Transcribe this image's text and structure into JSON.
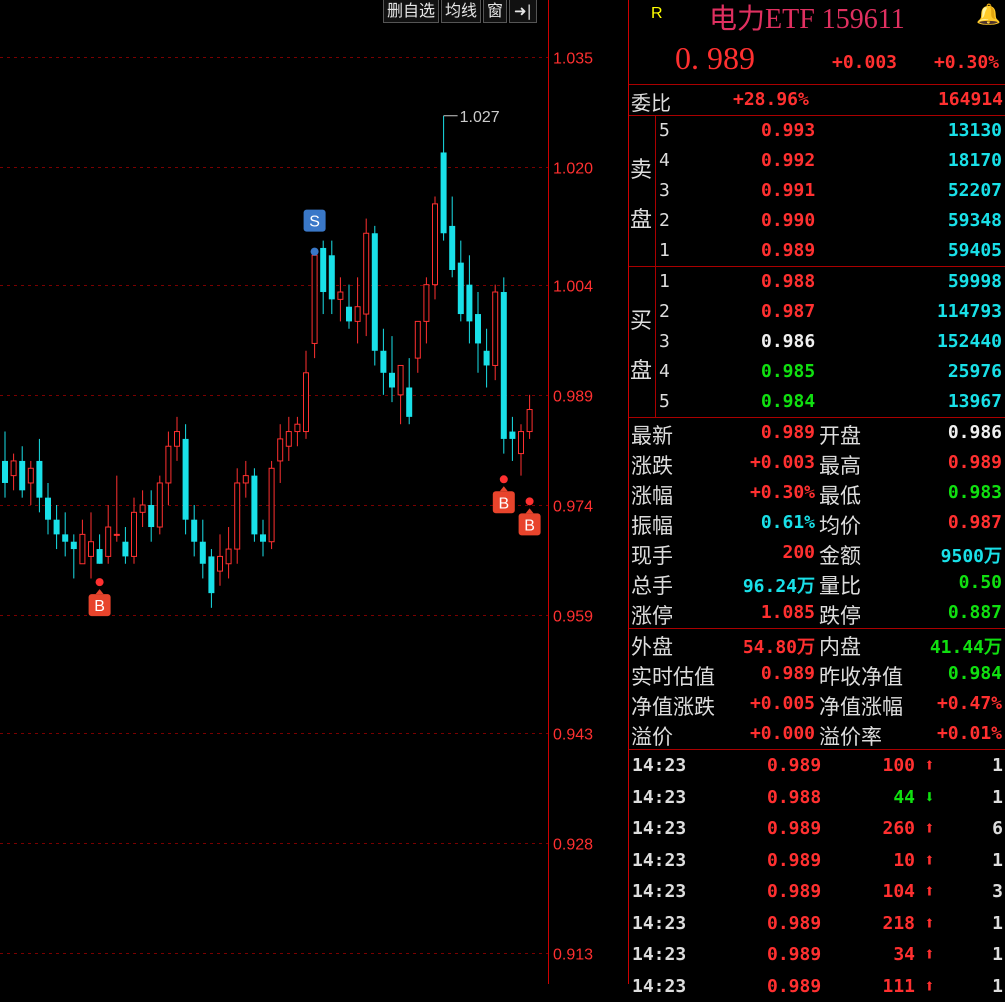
{
  "toolbar": {
    "delete_label": "删自选",
    "ma_label": "均线",
    "window_label": "窗",
    "collapse_label": "➜|"
  },
  "chart_data": {
    "type": "candlestick",
    "y_ticks": [
      "1.035",
      "1.020",
      "1.004",
      "0.989",
      "0.974",
      "0.959",
      "0.943",
      "0.928",
      "0.913"
    ],
    "ylim": [
      0.913,
      1.035
    ],
    "peak_label": "1.027",
    "colors": {
      "up": "#ff3030",
      "down": "#19e0e8",
      "grid": "#7a0000",
      "tick": "#ff3030"
    },
    "candles": [
      {
        "o": 0.98,
        "h": 0.984,
        "l": 0.975,
        "c": 0.977
      },
      {
        "o": 0.978,
        "h": 0.981,
        "l": 0.976,
        "c": 0.98
      },
      {
        "o": 0.98,
        "h": 0.982,
        "l": 0.975,
        "c": 0.976
      },
      {
        "o": 0.977,
        "h": 0.98,
        "l": 0.974,
        "c": 0.979
      },
      {
        "o": 0.98,
        "h": 0.983,
        "l": 0.973,
        "c": 0.975
      },
      {
        "o": 0.975,
        "h": 0.977,
        "l": 0.97,
        "c": 0.972
      },
      {
        "o": 0.972,
        "h": 0.974,
        "l": 0.968,
        "c": 0.97
      },
      {
        "o": 0.97,
        "h": 0.973,
        "l": 0.967,
        "c": 0.969
      },
      {
        "o": 0.969,
        "h": 0.97,
        "l": 0.964,
        "c": 0.968
      },
      {
        "o": 0.966,
        "h": 0.972,
        "l": 0.966,
        "c": 0.97
      },
      {
        "o": 0.967,
        "h": 0.973,
        "l": 0.964,
        "c": 0.969
      },
      {
        "o": 0.968,
        "h": 0.97,
        "l": 0.966,
        "c": 0.966
      },
      {
        "o": 0.967,
        "h": 0.974,
        "l": 0.966,
        "c": 0.971
      },
      {
        "o": 0.97,
        "h": 0.978,
        "l": 0.969,
        "c": 0.97
      },
      {
        "o": 0.969,
        "h": 0.971,
        "l": 0.966,
        "c": 0.967
      },
      {
        "o": 0.967,
        "h": 0.975,
        "l": 0.966,
        "c": 0.973
      },
      {
        "o": 0.973,
        "h": 0.976,
        "l": 0.971,
        "c": 0.974
      },
      {
        "o": 0.974,
        "h": 0.976,
        "l": 0.969,
        "c": 0.971
      },
      {
        "o": 0.971,
        "h": 0.978,
        "l": 0.97,
        "c": 0.977
      },
      {
        "o": 0.977,
        "h": 0.984,
        "l": 0.974,
        "c": 0.982
      },
      {
        "o": 0.982,
        "h": 0.986,
        "l": 0.98,
        "c": 0.984
      },
      {
        "o": 0.983,
        "h": 0.985,
        "l": 0.97,
        "c": 0.972
      },
      {
        "o": 0.972,
        "h": 0.974,
        "l": 0.967,
        "c": 0.969
      },
      {
        "o": 0.969,
        "h": 0.972,
        "l": 0.964,
        "c": 0.966
      },
      {
        "o": 0.967,
        "h": 0.968,
        "l": 0.96,
        "c": 0.962
      },
      {
        "o": 0.965,
        "h": 0.97,
        "l": 0.963,
        "c": 0.967
      },
      {
        "o": 0.966,
        "h": 0.971,
        "l": 0.964,
        "c": 0.968
      },
      {
        "o": 0.968,
        "h": 0.979,
        "l": 0.966,
        "c": 0.977
      },
      {
        "o": 0.977,
        "h": 0.98,
        "l": 0.975,
        "c": 0.978
      },
      {
        "o": 0.978,
        "h": 0.979,
        "l": 0.969,
        "c": 0.97
      },
      {
        "o": 0.97,
        "h": 0.972,
        "l": 0.967,
        "c": 0.969
      },
      {
        "o": 0.969,
        "h": 0.98,
        "l": 0.968,
        "c": 0.979
      },
      {
        "o": 0.98,
        "h": 0.985,
        "l": 0.977,
        "c": 0.983
      },
      {
        "o": 0.982,
        "h": 0.986,
        "l": 0.98,
        "c": 0.984
      },
      {
        "o": 0.984,
        "h": 0.986,
        "l": 0.982,
        "c": 0.985
      },
      {
        "o": 0.984,
        "h": 0.995,
        "l": 0.983,
        "c": 0.992
      },
      {
        "o": 0.996,
        "h": 1.009,
        "l": 0.994,
        "c": 1.008
      },
      {
        "o": 1.009,
        "h": 1.01,
        "l": 1.0,
        "c": 1.003
      },
      {
        "o": 1.008,
        "h": 1.01,
        "l": 1.0,
        "c": 1.002
      },
      {
        "o": 1.002,
        "h": 1.005,
        "l": 0.999,
        "c": 1.003
      },
      {
        "o": 1.001,
        "h": 1.004,
        "l": 0.998,
        "c": 0.999
      },
      {
        "o": 0.999,
        "h": 1.005,
        "l": 0.996,
        "c": 1.001
      },
      {
        "o": 1.0,
        "h": 1.013,
        "l": 0.997,
        "c": 1.011
      },
      {
        "o": 1.011,
        "h": 1.012,
        "l": 0.993,
        "c": 0.995
      },
      {
        "o": 0.995,
        "h": 0.998,
        "l": 0.989,
        "c": 0.992
      },
      {
        "o": 0.992,
        "h": 0.997,
        "l": 0.988,
        "c": 0.99
      },
      {
        "o": 0.989,
        "h": 0.993,
        "l": 0.985,
        "c": 0.993
      },
      {
        "o": 0.99,
        "h": 0.994,
        "l": 0.985,
        "c": 0.986
      },
      {
        "o": 0.994,
        "h": 0.999,
        "l": 0.992,
        "c": 0.999
      },
      {
        "o": 0.999,
        "h": 1.005,
        "l": 0.996,
        "c": 1.004
      },
      {
        "o": 1.004,
        "h": 1.016,
        "l": 1.002,
        "c": 1.015
      },
      {
        "o": 1.022,
        "h": 1.027,
        "l": 1.01,
        "c": 1.011
      },
      {
        "o": 1.012,
        "h": 1.016,
        "l": 1.005,
        "c": 1.006
      },
      {
        "o": 1.007,
        "h": 1.01,
        "l": 0.999,
        "c": 1.0
      },
      {
        "o": 1.004,
        "h": 1.008,
        "l": 0.996,
        "c": 0.999
      },
      {
        "o": 1.0,
        "h": 1.003,
        "l": 0.992,
        "c": 0.996
      },
      {
        "o": 0.995,
        "h": 0.998,
        "l": 0.99,
        "c": 0.993
      },
      {
        "o": 0.993,
        "h": 1.004,
        "l": 0.991,
        "c": 1.003
      },
      {
        "o": 1.003,
        "h": 1.005,
        "l": 0.981,
        "c": 0.983
      },
      {
        "o": 0.984,
        "h": 0.986,
        "l": 0.98,
        "c": 0.983
      },
      {
        "o": 0.981,
        "h": 0.985,
        "l": 0.978,
        "c": 0.984
      },
      {
        "o": 0.984,
        "h": 0.989,
        "l": 0.983,
        "c": 0.987
      }
    ],
    "markers": [
      {
        "label": "B",
        "index": 11,
        "price": 0.9635,
        "below": true
      },
      {
        "label": "S",
        "index": 36,
        "price": 1.0085,
        "below": false
      },
      {
        "label": "B",
        "index": 58,
        "price": 0.9775,
        "below": true
      },
      {
        "label": "B",
        "index": 61,
        "price": 0.9745,
        "below": true
      }
    ]
  },
  "quote": {
    "r_label": "R",
    "title": "电力ETF 159611",
    "bell": "🔔",
    "price": "0. 989",
    "change": "+0.003",
    "change_pct": "+0.30%",
    "weibi_label": "委比",
    "weibi_pct": "+28.96%",
    "weibi_diff": "164914"
  },
  "order_book": {
    "sell_label_1": "卖",
    "sell_label_2": "盘",
    "buy_label_1": "买",
    "buy_label_2": "盘",
    "asks": [
      {
        "level": "5",
        "price": "0.993",
        "vol": "13130",
        "color": "red"
      },
      {
        "level": "4",
        "price": "0.992",
        "vol": "18170",
        "color": "red"
      },
      {
        "level": "3",
        "price": "0.991",
        "vol": "52207",
        "color": "red"
      },
      {
        "level": "2",
        "price": "0.990",
        "vol": "59348",
        "color": "red"
      },
      {
        "level": "1",
        "price": "0.989",
        "vol": "59405",
        "color": "red"
      }
    ],
    "bids": [
      {
        "level": "1",
        "price": "0.988",
        "vol": "59998",
        "color": "red"
      },
      {
        "level": "2",
        "price": "0.987",
        "vol": "114793",
        "color": "red"
      },
      {
        "level": "3",
        "price": "0.986",
        "vol": "152440",
        "color": "white"
      },
      {
        "level": "4",
        "price": "0.985",
        "vol": "25976",
        "color": "green"
      },
      {
        "level": "5",
        "price": "0.984",
        "vol": "13967",
        "color": "green"
      }
    ]
  },
  "stats": [
    [
      {
        "l": "最新",
        "v": "0.989",
        "c": "red"
      },
      {
        "l": "开盘",
        "v": "0.986",
        "c": "white"
      }
    ],
    [
      {
        "l": "涨跌",
        "v": "+0.003",
        "c": "red"
      },
      {
        "l": "最高",
        "v": "0.989",
        "c": "red"
      }
    ],
    [
      {
        "l": "涨幅",
        "v": "+0.30%",
        "c": "red"
      },
      {
        "l": "最低",
        "v": "0.983",
        "c": "green"
      }
    ],
    [
      {
        "l": "振幅",
        "v": "0.61%",
        "c": "cyan"
      },
      {
        "l": "均价",
        "v": "0.987",
        "c": "red"
      }
    ],
    [
      {
        "l": "现手",
        "v": "200",
        "c": "red"
      },
      {
        "l": "金额",
        "v": "9500万",
        "c": "cyan"
      }
    ],
    [
      {
        "l": "总手",
        "v": "96.24万",
        "c": "cyan"
      },
      {
        "l": "量比",
        "v": "0.50",
        "c": "green"
      }
    ],
    [
      {
        "l": "涨停",
        "v": "1.085",
        "c": "red"
      },
      {
        "l": "跌停",
        "v": "0.887",
        "c": "green"
      }
    ]
  ],
  "stats2": [
    [
      {
        "l": "外盘",
        "v": "54.80万",
        "c": "red"
      },
      {
        "l": "内盘",
        "v": "41.44万",
        "c": "green"
      }
    ],
    [
      {
        "l": "实时估值",
        "v": "0.989",
        "c": "red"
      },
      {
        "l": "昨收净值",
        "v": "0.984",
        "c": "green"
      }
    ],
    [
      {
        "l": "净值涨跌",
        "v": "+0.005",
        "c": "red"
      },
      {
        "l": "净值涨幅",
        "v": "+0.47%",
        "c": "red"
      }
    ],
    [
      {
        "l": "溢价",
        "v": "+0.000",
        "c": "red"
      },
      {
        "l": "溢价率",
        "v": "+0.01%",
        "c": "red"
      }
    ]
  ],
  "ticks": [
    {
      "t": "14:23",
      "p": "0.989",
      "q": "100",
      "dir": "up",
      "n": "1"
    },
    {
      "t": "14:23",
      "p": "0.988",
      "q": "44",
      "dir": "down",
      "n": "1"
    },
    {
      "t": "14:23",
      "p": "0.989",
      "q": "260",
      "dir": "up",
      "n": "6"
    },
    {
      "t": "14:23",
      "p": "0.989",
      "q": "10",
      "dir": "up",
      "n": "1"
    },
    {
      "t": "14:23",
      "p": "0.989",
      "q": "104",
      "dir": "up",
      "n": "3"
    },
    {
      "t": "14:23",
      "p": "0.989",
      "q": "218",
      "dir": "up",
      "n": "1"
    },
    {
      "t": "14:23",
      "p": "0.989",
      "q": "34",
      "dir": "up",
      "n": "1"
    },
    {
      "t": "14:23",
      "p": "0.989",
      "q": "111",
      "dir": "up",
      "n": "1"
    }
  ]
}
